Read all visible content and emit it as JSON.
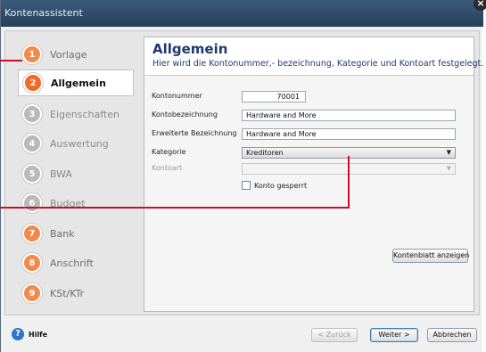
{
  "window": {
    "title": "Kontenassistent",
    "close_glyph": "×"
  },
  "steps": [
    {
      "num": "1",
      "label": "Vorlage",
      "state": "done"
    },
    {
      "num": "2",
      "label": "Allgemein",
      "state": "active"
    },
    {
      "num": "3",
      "label": "Eigenschaften",
      "state": "locked"
    },
    {
      "num": "4",
      "label": "Auswertung",
      "state": "locked"
    },
    {
      "num": "5",
      "label": "BWA",
      "state": "locked"
    },
    {
      "num": "6",
      "label": "Budget",
      "state": "locked"
    },
    {
      "num": "7",
      "label": "Bank",
      "state": "open"
    },
    {
      "num": "8",
      "label": "Anschrift",
      "state": "open"
    },
    {
      "num": "9",
      "label": "KSt/KTr",
      "state": "open"
    }
  ],
  "header": {
    "title": "Allgemein",
    "subtitle": "Hier wird die Kontonummer,- bezeichnung, Kategorie und Kontoart festgelegt."
  },
  "form": {
    "kontonummer": {
      "label": "Kontonummer",
      "value": "70001"
    },
    "kontobezeichnung": {
      "label": "Kontobezeichnung",
      "value": "Hardware and More"
    },
    "erweiterte": {
      "label": "Erweiterte Bezeichnung",
      "value": "Hardware and More"
    },
    "kategorie": {
      "label": "Kategorie",
      "value": "Kreditoren"
    },
    "kontoart": {
      "label": "Kontoart",
      "value": ""
    },
    "gesperrt": {
      "label": "Konto gesperrt",
      "checked": false
    },
    "kontenblatt_button": "Kontenblatt anzeigen"
  },
  "footer": {
    "help": "Hilfe",
    "back": "< Zurück",
    "next": "Weiter >",
    "cancel": "Abbrechen"
  },
  "colors": {
    "accent": "#f06a26",
    "title_blue": "#1f3a6e",
    "callout_red": "#c8102e"
  }
}
